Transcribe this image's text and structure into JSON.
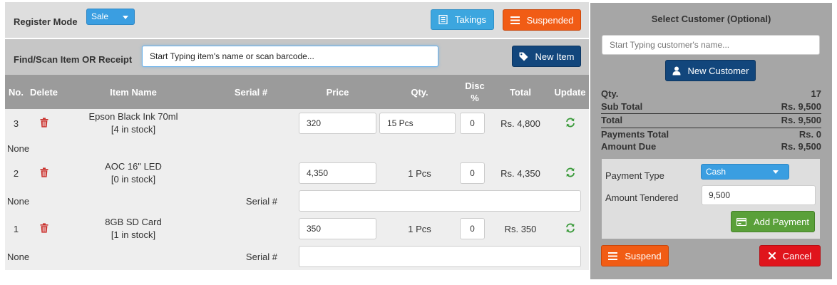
{
  "header": {
    "register_mode_label": "Register Mode",
    "register_mode_value": "Sale",
    "takings_label": "Takings",
    "suspended_label": "Suspended"
  },
  "find": {
    "label": "Find/Scan Item OR Receipt",
    "value": "Start Typing item's name or scan barcode...",
    "new_item_label": "New Item"
  },
  "table": {
    "headers": {
      "no": "No.",
      "delete": "Delete",
      "item_name": "Item Name",
      "serial": "Serial #",
      "price": "Price",
      "qty": "Qty.",
      "disc_line1": "Disc",
      "disc_line2": "%",
      "total": "Total",
      "update": "Update"
    },
    "rows": [
      {
        "no": "3",
        "name": "Epson Black Ink 70ml",
        "stock": "[4 in stock]",
        "price": "320",
        "qty": "15 Pcs",
        "qty_editable": true,
        "disc": "0",
        "total": "Rs. 4,800",
        "sub_left": "None",
        "serial_label": "",
        "serial_value": ""
      },
      {
        "no": "2",
        "name": "AOC 16\" LED",
        "stock": "[0 in stock]",
        "price": "4,350",
        "qty": "1 Pcs",
        "qty_editable": false,
        "disc": "0",
        "total": "Rs. 4,350",
        "sub_left": "None",
        "serial_label": "Serial #",
        "serial_value": ""
      },
      {
        "no": "1",
        "name": "8GB SD Card",
        "stock": "[1 in stock]",
        "price": "350",
        "qty": "1 Pcs",
        "qty_editable": false,
        "disc": "0",
        "total": "Rs. 350",
        "sub_left": "None",
        "serial_label": "Serial #",
        "serial_value": ""
      }
    ]
  },
  "customer": {
    "title": "Select Customer (Optional)",
    "placeholder": "Start Typing customer's name...",
    "new_customer_label": "New Customer"
  },
  "summary": {
    "qty_label": "Qty.",
    "qty_value": "17",
    "subtotal_label": "Sub Total",
    "subtotal_value": "Rs. 9,500",
    "total_label": "Total",
    "total_value": "Rs. 9,500",
    "payments_label": "Payments Total",
    "payments_value": "Rs. 0",
    "due_label": "Amount Due",
    "due_value": "Rs. 9,500"
  },
  "payment": {
    "type_label": "Payment Type",
    "type_value": "Cash",
    "tendered_label": "Amount Tendered",
    "tendered_value": "9,500",
    "add_payment_label": "Add Payment"
  },
  "actions": {
    "suspend_label": "Suspend",
    "cancel_label": "Cancel"
  },
  "colors": {
    "primary_blue": "#3ca6df",
    "dark_blue": "#12467c",
    "orange": "#f15c15",
    "green": "#5aa03a",
    "red": "#e0141c",
    "delete_icon": "#c9302c",
    "update_icon": "#3c9b3c"
  },
  "icons": {
    "takings": "list-icon",
    "suspended": "lines-icon",
    "new_item": "tag-icon",
    "new_customer": "user-icon",
    "add_payment": "card-icon",
    "suspend": "lines-icon",
    "cancel": "close-icon",
    "delete": "trash-icon",
    "update": "refresh-icon"
  }
}
